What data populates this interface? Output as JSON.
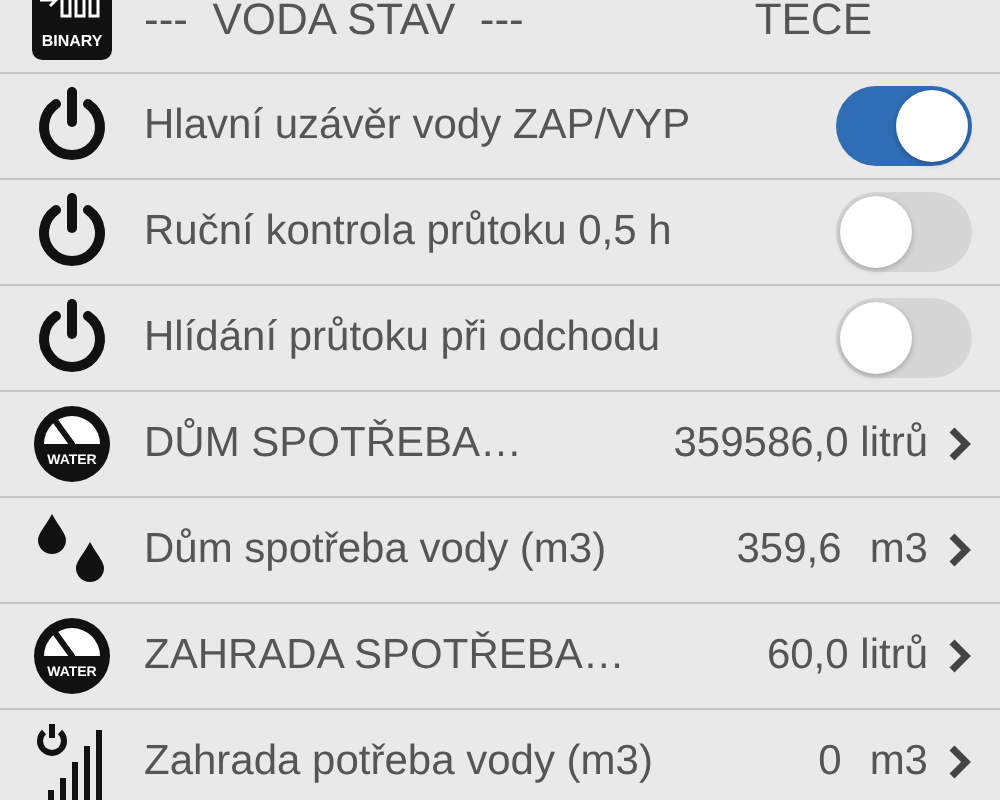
{
  "rows": [
    {
      "kind": "binary",
      "icon_label": "BINARY",
      "label": "---  VODA STAV  ---",
      "value": "TECE"
    },
    {
      "kind": "switch",
      "label": "Hlavní uzávěr vody ZAP/VYP",
      "on": true
    },
    {
      "kind": "switch",
      "label": "Ruční kontrola průtoku 0,5 h",
      "on": false
    },
    {
      "kind": "switch",
      "label": "Hlídání průtoku při odchodu",
      "on": false
    },
    {
      "kind": "meter",
      "icon_label": "WATER",
      "label": "DŮM SPOTŘEBA…",
      "value": "359586,0 litrů"
    },
    {
      "kind": "drops",
      "label": "Dům spotřeba vody (m3)",
      "value": "359,6",
      "unit": "m3"
    },
    {
      "kind": "meter",
      "icon_label": "WATER",
      "label": "ZAHRADA SPOTŘEBA…",
      "value": "60,0 litrů"
    },
    {
      "kind": "signal",
      "label": "Zahrada potřeba vody (m3)",
      "value": "0",
      "unit": "m3"
    }
  ]
}
